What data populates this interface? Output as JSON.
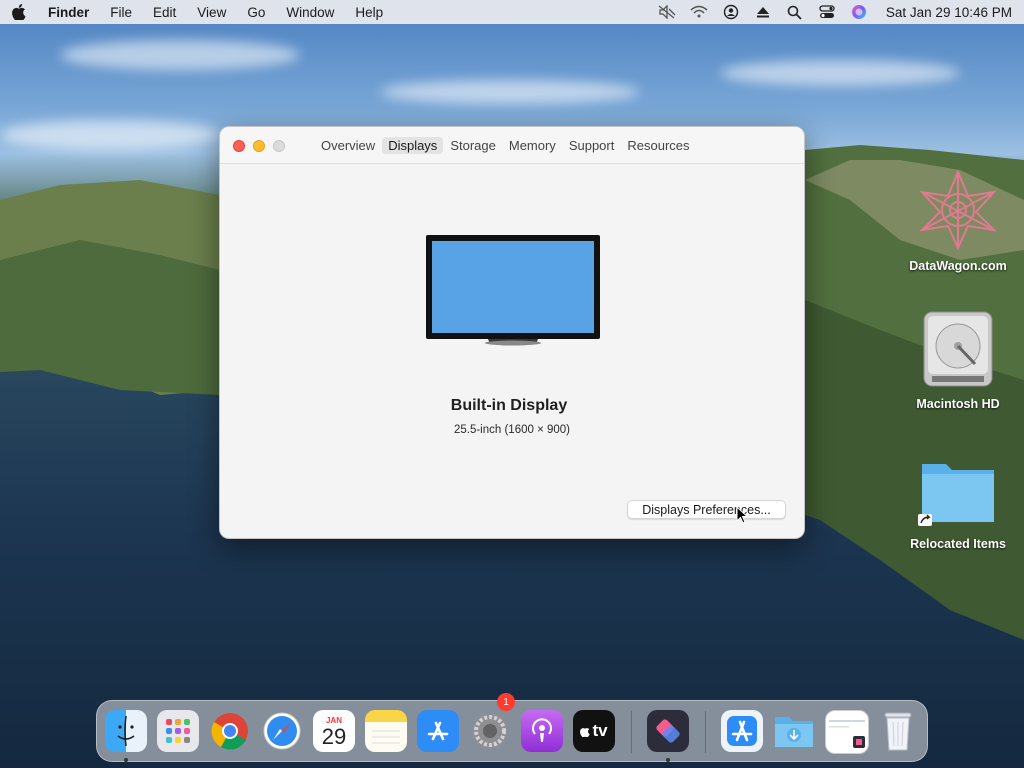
{
  "menubar": {
    "app": "Finder",
    "items": [
      "File",
      "Edit",
      "View",
      "Go",
      "Window",
      "Help"
    ],
    "clock": "Sat Jan 29  10:46 PM",
    "status_icons": [
      "mute-icon",
      "wifi-icon",
      "user-icon",
      "eject-icon",
      "search-icon",
      "control-center-icon",
      "siri-icon"
    ]
  },
  "window": {
    "tabs": [
      "Overview",
      "Displays",
      "Storage",
      "Memory",
      "Support",
      "Resources"
    ],
    "active_tab": "Displays",
    "display_name": "Built-in Display",
    "display_spec": "25.5-inch (1600 × 900)",
    "prefs_button": "Displays Preferences..."
  },
  "desktop": {
    "icons": [
      {
        "label": "DataWagon.com",
        "icon": "datawagon-logo-icon"
      },
      {
        "label": "Macintosh HD",
        "icon": "hard-drive-icon"
      },
      {
        "label": "Relocated Items",
        "icon": "folder-alias-icon"
      }
    ]
  },
  "dock": {
    "apps": [
      "finder-icon",
      "launchpad-icon",
      "chrome-icon",
      "safari-icon",
      "calendar-icon",
      "notes-icon",
      "app-store-icon",
      "system-preferences-icon",
      "podcasts-icon",
      "apple-tv-icon",
      "shortcuts-icon",
      "app-store-folder-icon",
      "downloads-folder-icon",
      "screenshot-icon",
      "trash-icon"
    ],
    "calendar_month": "JAN",
    "calendar_day": "29",
    "tv_label": "tv",
    "badge": "1"
  }
}
